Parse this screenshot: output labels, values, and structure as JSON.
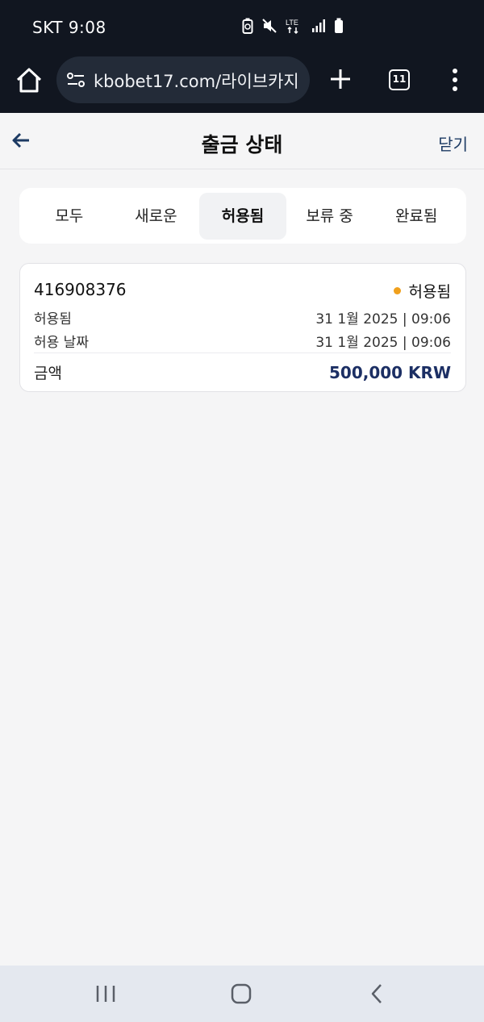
{
  "status_bar": {
    "carrier_time": "SKT 9:08",
    "network_label": "LTE"
  },
  "browser": {
    "url": "kbobet17.com/라이브카지",
    "tab_count": "11"
  },
  "header": {
    "title": "출금 상태",
    "close_label": "닫기"
  },
  "filters": {
    "tabs": [
      "모두",
      "새로운",
      "허용됨",
      "보류 중",
      "완료됨"
    ],
    "active_index": 2
  },
  "transaction": {
    "id": "416908376",
    "status": "허용됨",
    "status_color": "#f0a01c",
    "rows": [
      {
        "label": "허용됨",
        "value": "31 1월 2025 | 09:06"
      },
      {
        "label": "허용 날짜",
        "value": "31 1월 2025 | 09:06"
      }
    ],
    "amount_label": "금액",
    "amount_value": "500,000 KRW",
    "amount_color": "#1c2f64"
  },
  "colors": {
    "browser_bg": "#111620",
    "accent": "#1c3a63",
    "page_bg": "#f5f5f6"
  }
}
